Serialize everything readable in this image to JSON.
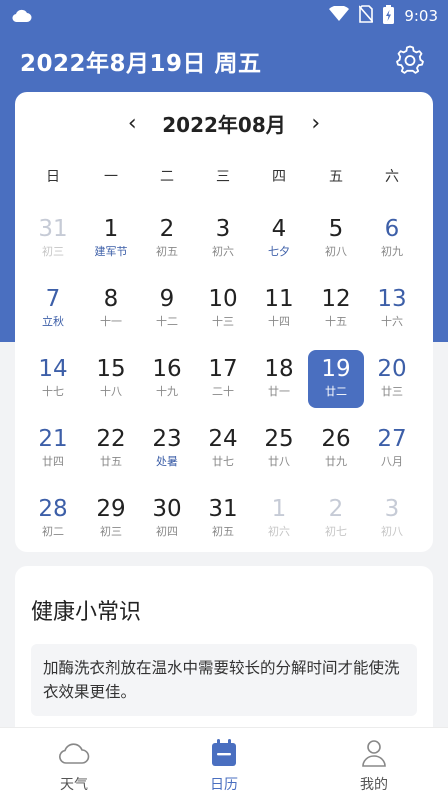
{
  "status_bar": {
    "time": "9:03"
  },
  "header": {
    "title": "2022年8月19日 周五"
  },
  "calendar": {
    "month_label": "2022年08月",
    "weekdays": [
      "日",
      "一",
      "二",
      "三",
      "四",
      "五",
      "六"
    ],
    "weeks": [
      [
        {
          "day": "31",
          "lunar": "初三",
          "other": true
        },
        {
          "day": "1",
          "lunar": "建军节",
          "festival": true
        },
        {
          "day": "2",
          "lunar": "初五"
        },
        {
          "day": "3",
          "lunar": "初六"
        },
        {
          "day": "4",
          "lunar": "七夕",
          "festival": true
        },
        {
          "day": "5",
          "lunar": "初八"
        },
        {
          "day": "6",
          "lunar": "初九"
        }
      ],
      [
        {
          "day": "7",
          "lunar": "立秋",
          "festival": true
        },
        {
          "day": "8",
          "lunar": "十一"
        },
        {
          "day": "9",
          "lunar": "十二"
        },
        {
          "day": "10",
          "lunar": "十三"
        },
        {
          "day": "11",
          "lunar": "十四"
        },
        {
          "day": "12",
          "lunar": "十五"
        },
        {
          "day": "13",
          "lunar": "十六"
        }
      ],
      [
        {
          "day": "14",
          "lunar": "十七"
        },
        {
          "day": "15",
          "lunar": "十八"
        },
        {
          "day": "16",
          "lunar": "十九"
        },
        {
          "day": "17",
          "lunar": "二十"
        },
        {
          "day": "18",
          "lunar": "廿一"
        },
        {
          "day": "19",
          "lunar": "廿二",
          "selected": true
        },
        {
          "day": "20",
          "lunar": "廿三"
        }
      ],
      [
        {
          "day": "21",
          "lunar": "廿四"
        },
        {
          "day": "22",
          "lunar": "廿五"
        },
        {
          "day": "23",
          "lunar": "处暑",
          "festival": true
        },
        {
          "day": "24",
          "lunar": "廿七"
        },
        {
          "day": "25",
          "lunar": "廿八"
        },
        {
          "day": "26",
          "lunar": "廿九"
        },
        {
          "day": "27",
          "lunar": "八月"
        }
      ],
      [
        {
          "day": "28",
          "lunar": "初二"
        },
        {
          "day": "29",
          "lunar": "初三"
        },
        {
          "day": "30",
          "lunar": "初四"
        },
        {
          "day": "31",
          "lunar": "初五"
        },
        {
          "day": "1",
          "lunar": "初六",
          "other": true
        },
        {
          "day": "2",
          "lunar": "初七",
          "other": true
        },
        {
          "day": "3",
          "lunar": "初八",
          "other": true
        }
      ]
    ]
  },
  "health": {
    "title": "健康小常识",
    "tip": "加酶洗衣剂放在温水中需要较长的分解时间才能使洗衣效果更佳。"
  },
  "tabs": [
    {
      "label": "天气",
      "icon": "cloud-icon"
    },
    {
      "label": "日历",
      "icon": "calendar-icon",
      "active": true
    },
    {
      "label": "我的",
      "icon": "user-icon"
    }
  ],
  "colors": {
    "accent": "#4a6fc0",
    "weekend": "#3d5fa8"
  }
}
